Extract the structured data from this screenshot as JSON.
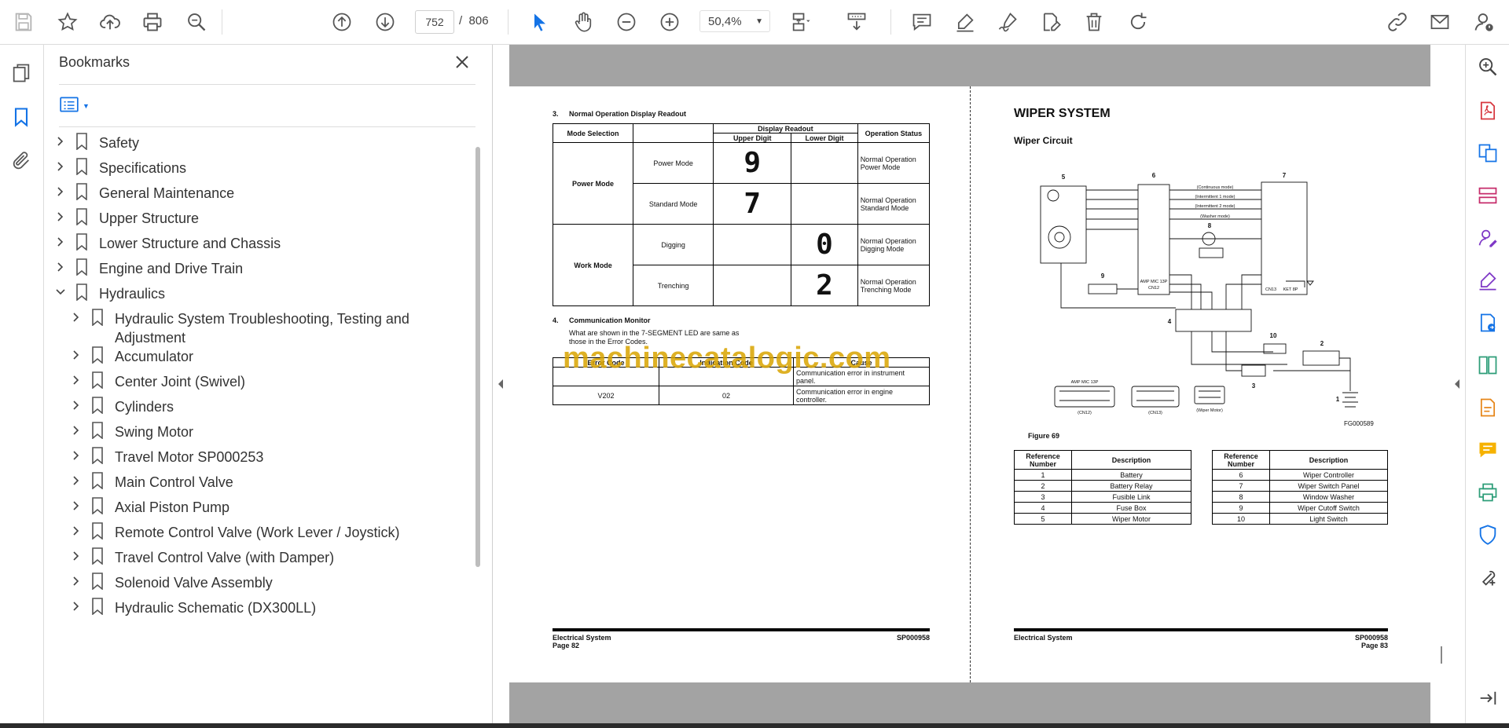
{
  "toolbar": {
    "page_current": "752",
    "page_separator": "/",
    "page_total": "806",
    "zoom": "50,4%"
  },
  "icons": [
    "save-icon",
    "star-icon",
    "upload-icon",
    "print-icon",
    "search-zoom-icon",
    "page-up-icon",
    "page-down-icon",
    "select-cursor-icon",
    "hand-icon",
    "zoom-out-icon",
    "zoom-in-icon",
    "fit-page-icon",
    "scroll-mode-icon",
    "comment-icon",
    "highlight-icon",
    "sign-icon",
    "edit-icon",
    "delete-icon",
    "rotate-icon",
    "share-link-icon",
    "mail-icon",
    "account-icon"
  ],
  "bookmarks": {
    "title": "Bookmarks",
    "items": [
      {
        "label": "Safety",
        "level": 0,
        "expanded": false
      },
      {
        "label": "Specifications",
        "level": 0,
        "expanded": false
      },
      {
        "label": "General Maintenance",
        "level": 0,
        "expanded": false
      },
      {
        "label": "Upper Structure",
        "level": 0,
        "expanded": false
      },
      {
        "label": "Lower Structure and Chassis",
        "level": 0,
        "expanded": false
      },
      {
        "label": "Engine and Drive Train",
        "level": 0,
        "expanded": false
      },
      {
        "label": "Hydraulics",
        "level": 0,
        "expanded": true
      },
      {
        "label": "Hydraulic System Troubleshooting, Testing and Adjustment",
        "level": 1,
        "expanded": false
      },
      {
        "label": "Accumulator",
        "level": 1,
        "expanded": false
      },
      {
        "label": "Center Joint (Swivel)",
        "level": 1,
        "expanded": false
      },
      {
        "label": "Cylinders",
        "level": 1,
        "expanded": false
      },
      {
        "label": "Swing Motor",
        "level": 1,
        "expanded": false
      },
      {
        "label": "Travel Motor SP000253",
        "level": 1,
        "expanded": false
      },
      {
        "label": "Main Control Valve",
        "level": 1,
        "expanded": false
      },
      {
        "label": "Axial Piston Pump",
        "level": 1,
        "expanded": false
      },
      {
        "label": "Remote Control Valve (Work Lever / Joystick)",
        "level": 1,
        "expanded": false
      },
      {
        "label": "Travel Control Valve (with Damper)",
        "level": 1,
        "expanded": false
      },
      {
        "label": "Solenoid Valve Assembly",
        "level": 1,
        "expanded": false
      },
      {
        "label": "Hydraulic Schematic (DX300LL)",
        "level": 1,
        "expanded": false
      }
    ]
  },
  "left_page": {
    "section3_num": "3.",
    "section3_title": "Normal Operation Display Readout",
    "table1": {
      "h_mode": "Mode Selection",
      "h_display": "Display Readout",
      "h_upper": "Upper Digit",
      "h_lower": "Lower Digit",
      "h_status": "Operation Status",
      "power_mode": "Power Mode",
      "work_mode": "Work Mode",
      "rows": [
        {
          "sub": "Power Mode",
          "upper": "9",
          "lower": "",
          "status1": "Normal Operation",
          "status2": "Power Mode"
        },
        {
          "sub": "Standard Mode",
          "upper": "7",
          "lower": "",
          "status1": "Normal Operation",
          "status2": "Standard Mode"
        },
        {
          "sub": "Digging",
          "upper": "",
          "lower": "0",
          "status1": "Normal Operation",
          "status2": "Digging Mode"
        },
        {
          "sub": "Trenching",
          "upper": "",
          "lower": "2",
          "status1": "Normal Operation",
          "status2": "Trenching Mode"
        }
      ]
    },
    "section4_num": "4.",
    "section4_title": "Communication Monitor",
    "section4_text1": "What are shown in the 7-SEGMENT LED are same as",
    "section4_text2": "those in the Error Codes.",
    "table2": {
      "h1": "Error Code",
      "h2": "Indication Code",
      "h3": "Cause",
      "rows": [
        {
          "c1": "",
          "c2": "",
          "c3a": "Communication error in instrument",
          "c3b": "panel."
        },
        {
          "c1": "V202",
          "c2": "02",
          "c3a": "Communication error in engine",
          "c3b": "controller."
        }
      ]
    },
    "footer_left": "Electrical System",
    "footer_page": "Page 82",
    "footer_code": "SP000958"
  },
  "watermark": "machinecatalogic.com",
  "right_page": {
    "title": "WIPER SYSTEM",
    "subtitle": "Wiper Circuit",
    "diagram_labels": [
      "5",
      "6",
      "7",
      "8",
      "9",
      "4",
      "10",
      "2",
      "3",
      "1"
    ],
    "diagram_notes": [
      "(Continuous mode)",
      "(Intermittent 1 mode)",
      "(Intermittent 2 mode)",
      "(Washer mode)",
      "AMP MIC 13P",
      "CN12",
      "CN13",
      "KET 8P"
    ],
    "connector_labels": [
      "AMP MIC 13P",
      "(CN12)",
      "(CN13)",
      "(Wiper Motor)"
    ],
    "fig_code": "FG000589",
    "figure": "Figure 69",
    "ref_header_num": "Reference Number",
    "ref_header_desc": "Description",
    "ref_left": [
      {
        "n": "1",
        "d": "Battery"
      },
      {
        "n": "2",
        "d": "Battery Relay"
      },
      {
        "n": "3",
        "d": "Fusible Link"
      },
      {
        "n": "4",
        "d": "Fuse Box"
      },
      {
        "n": "5",
        "d": "Wiper Motor"
      }
    ],
    "ref_right": [
      {
        "n": "6",
        "d": "Wiper Controller"
      },
      {
        "n": "7",
        "d": "Wiper Switch Panel"
      },
      {
        "n": "8",
        "d": "Window Washer"
      },
      {
        "n": "9",
        "d": "Wiper Cutoff Switch"
      },
      {
        "n": "10",
        "d": "Light Switch"
      }
    ],
    "footer_left": "Electrical System",
    "footer_page": "Page 83",
    "footer_code": "SP000958"
  },
  "colors": {
    "accent": "#1473e6",
    "rail_icon": "#c62d6b",
    "doc_gray": "#a3a3a3",
    "watermark": "#d9a400"
  }
}
